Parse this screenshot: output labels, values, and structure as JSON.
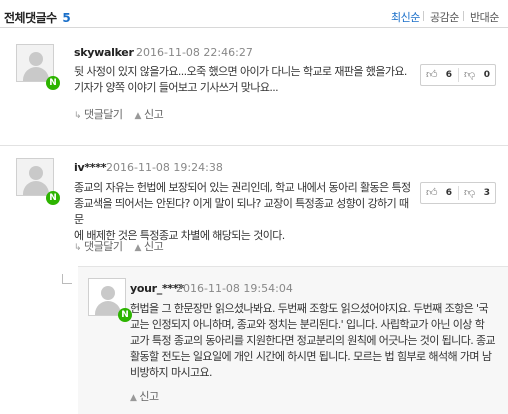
{
  "header": {
    "title": "전체댓글수",
    "count": "5",
    "sort_options": [
      {
        "label": "최신순",
        "active": true
      },
      {
        "label": "공감순",
        "active": false
      },
      {
        "label": "반대순",
        "active": false
      }
    ]
  },
  "comments": [
    {
      "author": "skywalker",
      "date": "2016-11-08 22:46:27",
      "lines": [
        "뒷 사정이 있지 않을가요...오죽 했으면 아이가 다니는 학교로 재판을 했을가요.",
        "기자가 양쪽 이야기 들어보고 기사쓰거 맞나요..."
      ],
      "likes": "6",
      "dislikes": "0",
      "reply_label": "댓글달기",
      "report_label": "신고"
    },
    {
      "author": "iv****",
      "date": "2016-11-08 19:24:38",
      "lines": [
        "종교의 자유는 헌법에 보장되어 있는 권리인데, 학교 내에서 동아리 활동은 특정",
        "종교색을 띄어서는 안된다? 이게 말이 되나? 교장이 특정종교 성향이 강하기 때문",
        "에 배제한 것은 특정종교 차별에 해당되는 것이다."
      ],
      "likes": "6",
      "dislikes": "3",
      "reply_label": "댓글달기",
      "report_label": "신고"
    }
  ],
  "reply": {
    "author": "your_****",
    "date": "2016-11-08 19:54:04",
    "lines": [
      "헌법을 그 한문장만 읽으셨나봐요. 두번째 조항도 읽으셨어야지요. 두번째 조항은 '국",
      "교는 인정되지 아니하며, 종교와 정치는 분리된다.' 입니다. 사립학교가 아닌 이상 학",
      "교가 특정 종교의 동아리를 지원한다면 정교분리의 원칙에 어긋나는 것이 됩니다. 종교",
      "활동할 전도는 일요일에 개인 시간에 하시면 됩니다. 모르는 법 힘부로 해석해 가며 남",
      "비방하지 마시고요."
    ],
    "report_label": "신고"
  },
  "icons": {
    "naver_badge": "N",
    "thumb_up": "thumb-up-icon",
    "thumb_down": "thumb-down-icon",
    "reply": "reply-arrow-icon",
    "report": "siren-icon"
  },
  "colors": {
    "accent": "#1a6fc9",
    "badge": "#2db400"
  }
}
